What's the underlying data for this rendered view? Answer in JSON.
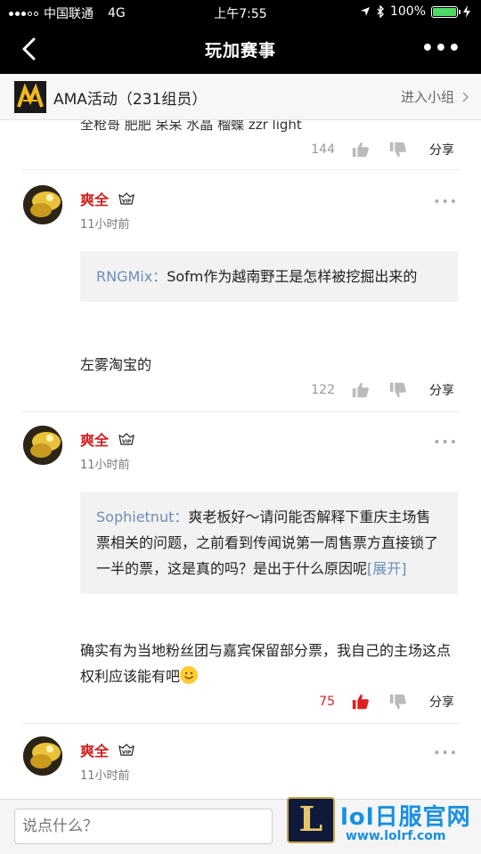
{
  "status_bar": {
    "carrier": "中国联通",
    "network": "4G",
    "time": "上午7:55",
    "battery": "100%"
  },
  "nav": {
    "title": "玩加赛事",
    "more": "•••"
  },
  "group": {
    "name": "AMA活动（231组员）",
    "join": "进入小组"
  },
  "feed": {
    "top_cut_text": "全枪哥 肥肥 呆呆 水晶 榴蝶 zzr light",
    "top_actions": {
      "likes": "144",
      "share": "分享"
    },
    "comments": [
      {
        "user": "爽全",
        "vip": "VIP",
        "time": "11小时前",
        "more": "•••",
        "quote_user": "RNGMix：",
        "quote_text": "Sofm作为越南野王是怎样被挖掘出来的",
        "quote_expand": "",
        "reply": "左雾淘宝的",
        "likes": "122",
        "share": "分享",
        "liked": false
      },
      {
        "user": "爽全",
        "vip": "VIP",
        "time": "11小时前",
        "more": "•••",
        "quote_user": "Sophietnut：",
        "quote_text": "爽老板好～请问能否解释下重庆主场售票相关的问题，之前看到传闻说第一周售票方直接锁了一半的票，这是真的吗？是出于什么原因呢",
        "quote_expand": "[展开]",
        "reply": "确实有为当地粉丝团与嘉宾保留部分票，我自己的主场这点权利应该能有吧",
        "likes": "75",
        "share": "分享",
        "liked": true
      },
      {
        "user": "爽全",
        "vip": "VIP",
        "time": "11小时前",
        "more": "•••"
      }
    ]
  },
  "input": {
    "placeholder": "说点什么？"
  },
  "watermark": {
    "logo_letter": "L",
    "title": "lol日服官网",
    "url": "www.lolrf.com"
  },
  "colors": {
    "username": "#d21d1d",
    "quote_name": "#6b8fb5",
    "liked": "#e02020",
    "nav_bg": "#000000"
  },
  "icons": [
    "back-icon",
    "more-icon",
    "thumb-up-icon",
    "thumb-down-icon",
    "chevron-right-icon",
    "vip-icon",
    "wifi-icon",
    "bluetooth-icon",
    "location-icon"
  ]
}
